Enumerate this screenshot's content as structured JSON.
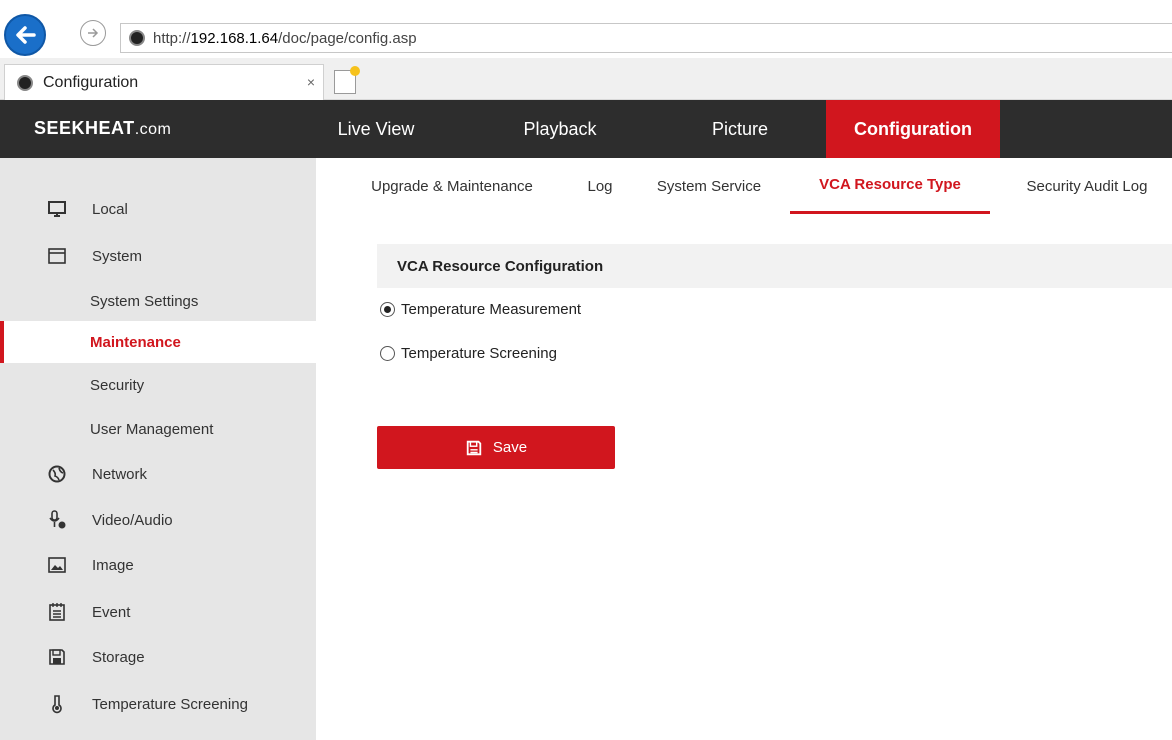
{
  "browser": {
    "url_prefix": "http://",
    "url_host": "192.168.1.64",
    "url_path": "/doc/page/config.asp",
    "tab_title": "Configuration",
    "tab_close": "×"
  },
  "header": {
    "logo_main": "SEEKHEAT",
    "logo_suffix": ".com",
    "nav": [
      {
        "label": "Live View"
      },
      {
        "label": "Playback"
      },
      {
        "label": "Picture"
      },
      {
        "label": "Configuration"
      }
    ],
    "active_color": "#d1161e"
  },
  "sidebar": {
    "items": [
      {
        "label": "Local",
        "icon": "monitor-icon"
      },
      {
        "label": "System",
        "icon": "window-icon"
      },
      {
        "label": "System Settings"
      },
      {
        "label": "Maintenance"
      },
      {
        "label": "Security"
      },
      {
        "label": "User Management"
      },
      {
        "label": "Network",
        "icon": "globe-icon"
      },
      {
        "label": "Video/Audio",
        "icon": "microphone-icon"
      },
      {
        "label": "Image",
        "icon": "image-icon"
      },
      {
        "label": "Event",
        "icon": "calendar-icon"
      },
      {
        "label": "Storage",
        "icon": "floppy-disk-icon"
      },
      {
        "label": "Temperature Screening",
        "icon": "thermometer-icon"
      }
    ],
    "active_item": "Maintenance"
  },
  "subtabs": [
    {
      "label": "Upgrade & Maintenance"
    },
    {
      "label": "Log"
    },
    {
      "label": "System Service"
    },
    {
      "label": "VCA Resource Type"
    },
    {
      "label": "Security Audit Log"
    }
  ],
  "main": {
    "section_title": "VCA Resource Configuration",
    "options": [
      {
        "label": "Temperature Measurement",
        "checked": true
      },
      {
        "label": "Temperature Screening",
        "checked": false
      }
    ],
    "save_label": "Save"
  }
}
